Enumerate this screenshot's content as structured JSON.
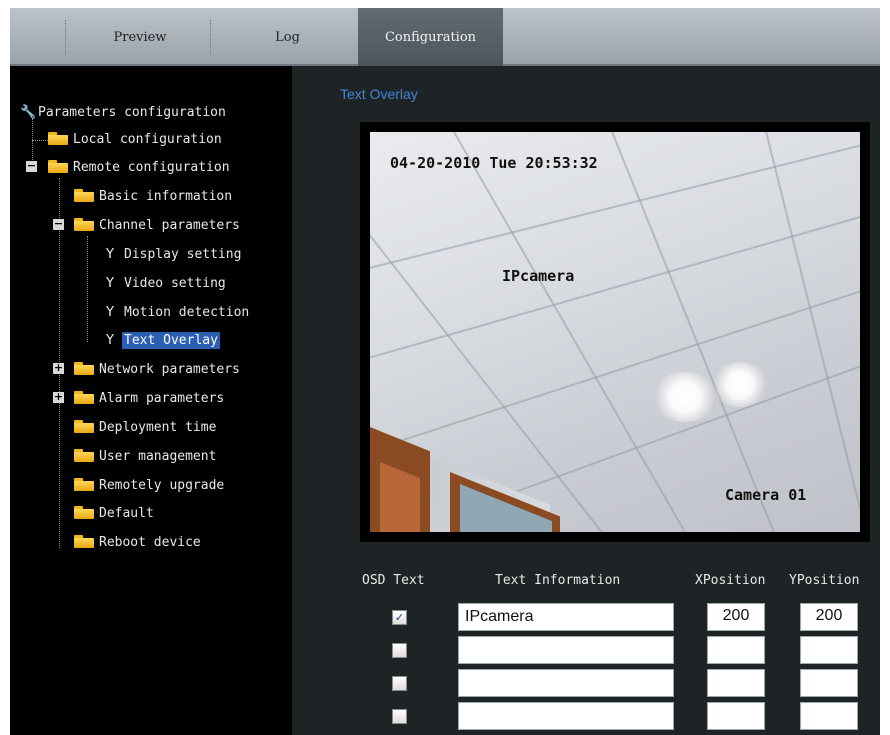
{
  "tabs": [
    {
      "label": "Preview"
    },
    {
      "label": "Log"
    },
    {
      "label": "Configuration",
      "active": true
    }
  ],
  "sidebar": {
    "items": [
      {
        "label": "Parameters configuration",
        "icon": "wrench-icon"
      },
      {
        "label": "Local configuration",
        "icon": "folder-icon"
      },
      {
        "label": "Remote configuration",
        "icon": "folder-icon",
        "toggle": "minus"
      },
      {
        "label": "Basic information",
        "icon": "folder-icon"
      },
      {
        "label": "Channel parameters",
        "icon": "folder-icon",
        "toggle": "minus"
      },
      {
        "label": "Display setting",
        "icon": "wrench-icon"
      },
      {
        "label": "Video setting",
        "icon": "wrench-icon"
      },
      {
        "label": "Motion detection",
        "icon": "wrench-icon"
      },
      {
        "label": "Text Overlay",
        "icon": "wrench-icon",
        "selected": true
      },
      {
        "label": "Network parameters",
        "icon": "folder-icon",
        "toggle": "plus"
      },
      {
        "label": "Alarm parameters",
        "icon": "folder-icon",
        "toggle": "plus"
      },
      {
        "label": "Deployment time",
        "icon": "folder-icon"
      },
      {
        "label": "User management",
        "icon": "folder-icon"
      },
      {
        "label": "Remotely upgrade",
        "icon": "folder-icon"
      },
      {
        "label": "Default",
        "icon": "folder-icon"
      },
      {
        "label": "Reboot device",
        "icon": "folder-icon"
      }
    ]
  },
  "main": {
    "title": "Text Overlay",
    "preview": {
      "timestamp": "04-20-2010 Tue 20:53:32",
      "overlay_text": "IPcamera",
      "camera_name": "Camera 01"
    },
    "table": {
      "headers": {
        "osd_text": "OSD Text",
        "text_information": "Text Information",
        "xposition": "XPosition",
        "yposition": "YPosition"
      },
      "rows": [
        {
          "checked": true,
          "text": "IPcamera",
          "x": "200",
          "y": "200"
        },
        {
          "checked": false,
          "text": "",
          "x": "",
          "y": ""
        },
        {
          "checked": false,
          "text": "",
          "x": "",
          "y": ""
        },
        {
          "checked": false,
          "text": "",
          "x": "",
          "y": ""
        }
      ]
    }
  },
  "colors": {
    "background": "#1e2326",
    "sidebar": "#000000",
    "selected": "#2a5fb3",
    "title_accent": "#3f86d8",
    "folder": "#f0b820"
  }
}
